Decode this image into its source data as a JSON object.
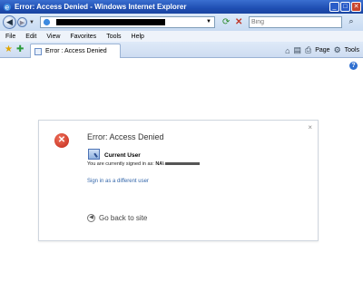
{
  "window": {
    "title": "Error: Access Denied - Windows Internet Explorer",
    "minimize": "_",
    "maximize": "□",
    "close": "✕"
  },
  "address": {
    "back": "◀",
    "forward": "▶",
    "search_placeholder": "Bing",
    "refresh": "⟳",
    "stop": "✕",
    "search_go": "⌕"
  },
  "menu": [
    "File",
    "Edit",
    "View",
    "Favorites",
    "Tools",
    "Help"
  ],
  "tab": {
    "label": "Error : Access Denied"
  },
  "commands": {
    "home": "⌂",
    "feeds": "▤",
    "print": "⎙",
    "page": "Page",
    "tools": "Tools"
  },
  "page": {
    "help": "?",
    "dialog": {
      "close": "×",
      "title": "Error: Access Denied",
      "user_heading": "Current User",
      "signed_in_prefix": "You are currently signed in as:",
      "signed_in_user": "NA\\",
      "different_user_link": "Sign in as a different user",
      "go_back": "Go back to site"
    }
  },
  "colors": {
    "title_bar": "#1f4fb3",
    "error_red": "#c0281a",
    "link_blue": "#3366aa"
  }
}
